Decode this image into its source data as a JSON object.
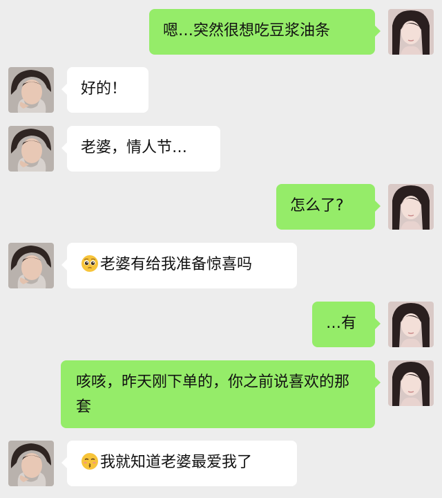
{
  "messages": [
    {
      "side": "right",
      "sender": "wife",
      "text": "嗯…突然很想吃豆浆油条"
    },
    {
      "side": "left",
      "sender": "husband",
      "text": "好的！"
    },
    {
      "side": "left",
      "sender": "husband",
      "text": "老婆，情人节…"
    },
    {
      "side": "right",
      "sender": "wife",
      "text": "怎么了?"
    },
    {
      "side": "left",
      "sender": "husband",
      "emoji": "pleading-face",
      "text": "老婆有给我准备惊喜吗"
    },
    {
      "side": "right",
      "sender": "wife",
      "text": "…有"
    },
    {
      "side": "right",
      "sender": "wife",
      "text": "咳咳，昨天刚下单的，你之前说喜欢的那套"
    },
    {
      "side": "left",
      "sender": "husband",
      "emoji": "kissing-face",
      "text": "我就知道老婆最爱我了"
    }
  ],
  "colors": {
    "background": "#ededed",
    "bubble_self": "#95ec69",
    "bubble_other": "#ffffff"
  }
}
